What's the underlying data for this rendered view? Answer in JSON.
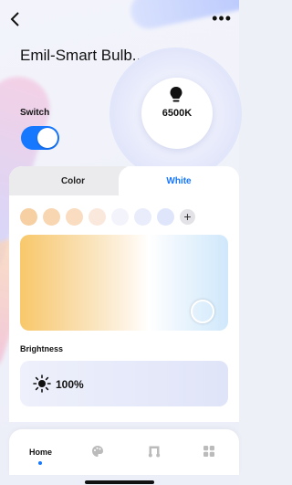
{
  "header": {
    "back_icon": "chevron-left-icon",
    "more_icon": "ellipsis-icon"
  },
  "device": {
    "name": "Emil-Smart Bulb...",
    "color_temperature": "6500K"
  },
  "switch": {
    "label": "Switch",
    "on": true,
    "accent": "#1677ff"
  },
  "tabs": [
    {
      "label": "Color",
      "active": false
    },
    {
      "label": "White",
      "active": true
    }
  ],
  "swatches": [
    "#f6cfa2",
    "#f8d6b2",
    "#fadcc0",
    "#fbe8dc",
    "#f3f3fb",
    "#e9ecfb",
    "#dfe6fb"
  ],
  "add_swatch": "+",
  "brightness": {
    "label": "Brightness",
    "value": "100%",
    "icon": "sun-icon"
  },
  "nav": [
    {
      "label": "Home",
      "icon": "home",
      "active": true
    },
    {
      "label": "",
      "icon": "palette-icon",
      "active": false
    },
    {
      "label": "",
      "icon": "music-icon",
      "active": false
    },
    {
      "label": "",
      "icon": "grid-icon",
      "active": false
    }
  ]
}
